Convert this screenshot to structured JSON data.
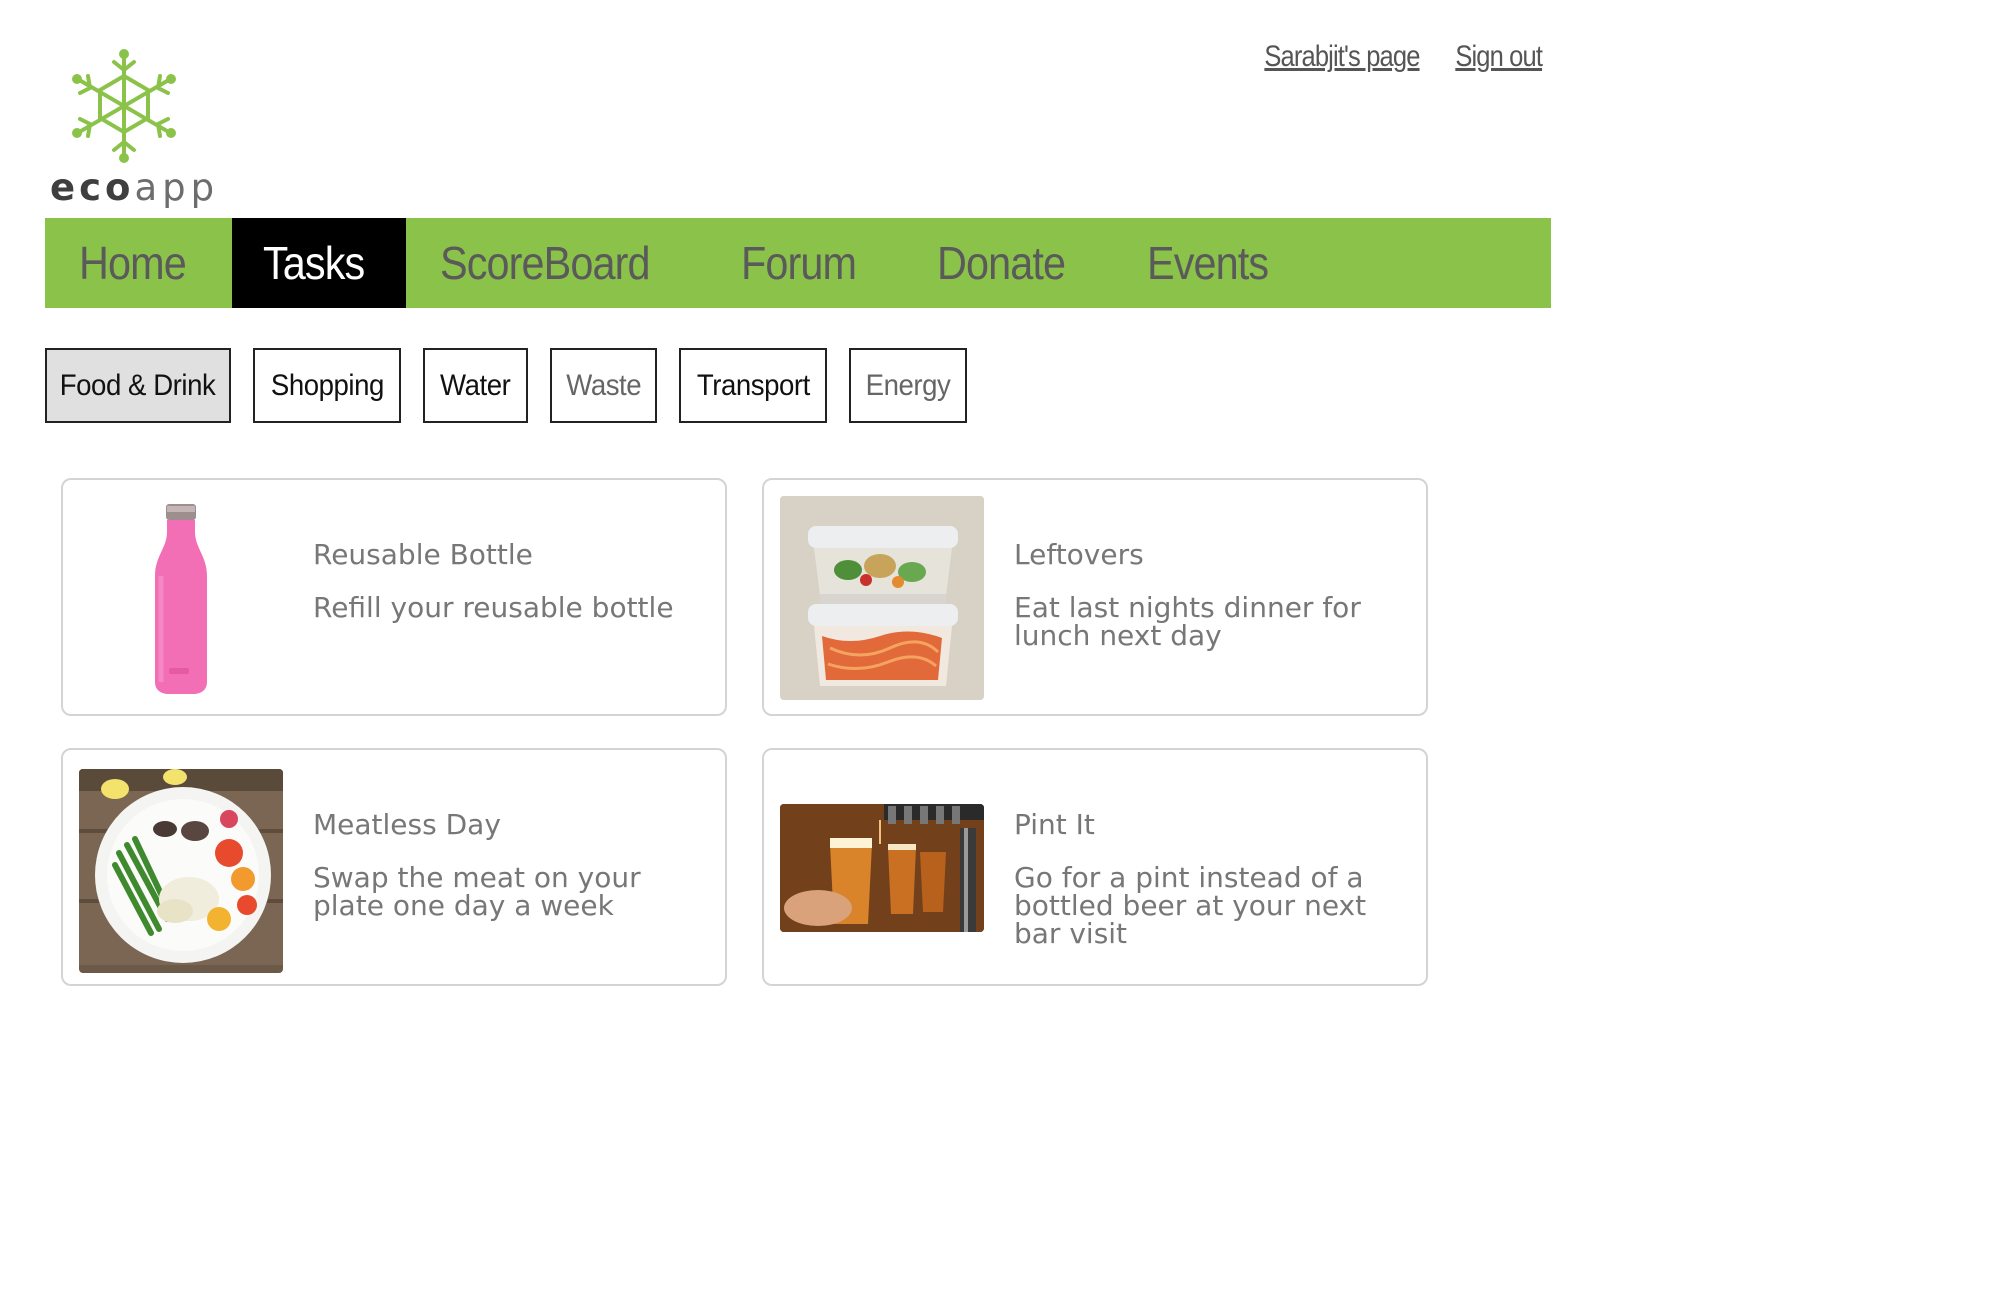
{
  "brand": {
    "name_bold": "eco",
    "name_light": "app",
    "color": "#8bc34a"
  },
  "user_links": {
    "profile": "Sarabjit's page",
    "signout": "Sign out"
  },
  "nav": {
    "items": [
      {
        "label": "Home",
        "active": false
      },
      {
        "label": "Tasks",
        "active": true
      },
      {
        "label": "ScoreBoard",
        "active": false
      },
      {
        "label": "Forum",
        "active": false
      },
      {
        "label": "Donate",
        "active": false
      },
      {
        "label": "Events",
        "active": false
      }
    ],
    "bg_color": "#8bc34a",
    "active_color": "#000000"
  },
  "categories": [
    {
      "label": "Food & Drink",
      "selected": true
    },
    {
      "label": "Shopping",
      "selected": false
    },
    {
      "label": "Water",
      "selected": false
    },
    {
      "label": "Waste",
      "selected": false
    },
    {
      "label": "Transport",
      "selected": false
    },
    {
      "label": "Energy",
      "selected": false
    }
  ],
  "tasks": [
    {
      "title": "Reusable Bottle",
      "description": "Refill your reusable bottle",
      "image": "pink-water-bottle"
    },
    {
      "title": "Leftovers",
      "description": "Eat last nights dinner for lunch next day",
      "image": "stacked-food-containers"
    },
    {
      "title": "Meatless Day",
      "description": "Swap the meat on your plate one day a week",
      "image": "vegetable-plate"
    },
    {
      "title": "Pint It",
      "description": "Go for a pint instead of a bottled beer at your next bar visit",
      "image": "beer-tap-pint"
    }
  ]
}
